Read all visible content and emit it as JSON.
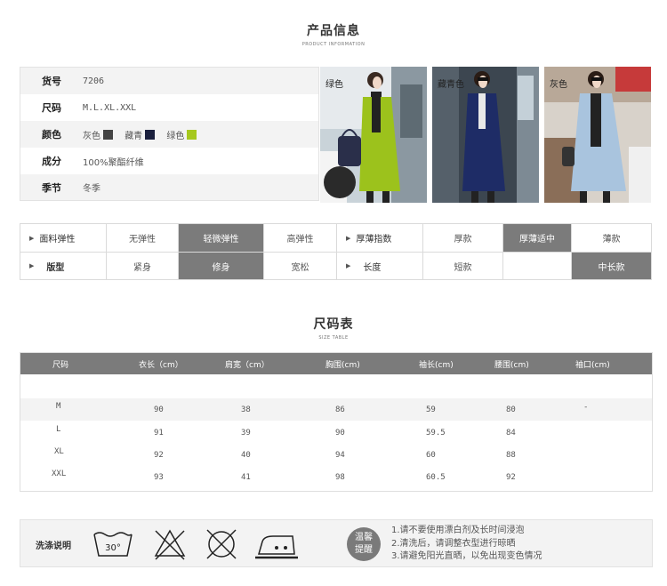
{
  "product_info": {
    "title_cn": "产品信息",
    "title_en": "PRODUCT INFORMATION",
    "rows": [
      {
        "label": "货号",
        "value": "7206"
      },
      {
        "label": "尺码",
        "value": "M.L.XL.XXL"
      },
      {
        "label": "颜色",
        "value": ""
      },
      {
        "label": "成分",
        "value": "100%聚酯纤维"
      },
      {
        "label": "季节",
        "value": "冬季"
      }
    ],
    "colors": [
      {
        "name": "灰色",
        "hex": "#444444"
      },
      {
        "name": "藏青",
        "hex": "#1a1f3d"
      },
      {
        "name": "绿色",
        "hex": "#a6c81e"
      }
    ]
  },
  "photos": [
    {
      "label": "绿色",
      "coat": "#9cc21c"
    },
    {
      "label": "藏青色",
      "coat": "#1e2c66"
    },
    {
      "label": "灰色",
      "coat": "#a9c4de"
    }
  ],
  "attributes": {
    "row1": {
      "head1": "面料弹性",
      "opts1": [
        "无弹性",
        "轻微弹性",
        "高弹性"
      ],
      "head2": "厚薄指数",
      "opts2": [
        "厚款",
        "厚薄适中",
        "薄款"
      ]
    },
    "row2": {
      "head1": "版型",
      "opts1": [
        "紧身",
        "修身",
        "宽松"
      ],
      "head2": "长度",
      "opts2": [
        "短款",
        "",
        "中长款"
      ]
    }
  },
  "size_table": {
    "title_cn": "尺码表",
    "title_en": "SIZE TABLE",
    "headers": [
      "尺码",
      "衣长（cm）",
      "肩宽（cm）",
      "胸围(cm)",
      "袖长(cm)",
      "腰围(cm)",
      "袖口(cm)"
    ],
    "rows": [
      [
        "M",
        "90",
        "38",
        "86",
        "59",
        "80",
        "-"
      ],
      [
        "L",
        "91",
        "39",
        "90",
        "59.5",
        "84",
        ""
      ],
      [
        "XL",
        "92",
        "40",
        "94",
        "60",
        "88",
        ""
      ],
      [
        "XXL",
        "93",
        "41",
        "98",
        "60.5",
        "92",
        ""
      ]
    ]
  },
  "care": {
    "label": "洗涤说明",
    "wash_temp": "30°",
    "badge_line1": "温馨",
    "badge_line2": "提醒",
    "tips": [
      "1.请不要使用漂白剂及长时间浸泡",
      "2.清洗后，请调整衣型进行晾晒",
      "3.请避免阳光直晒，以免出现变色情况"
    ]
  }
}
